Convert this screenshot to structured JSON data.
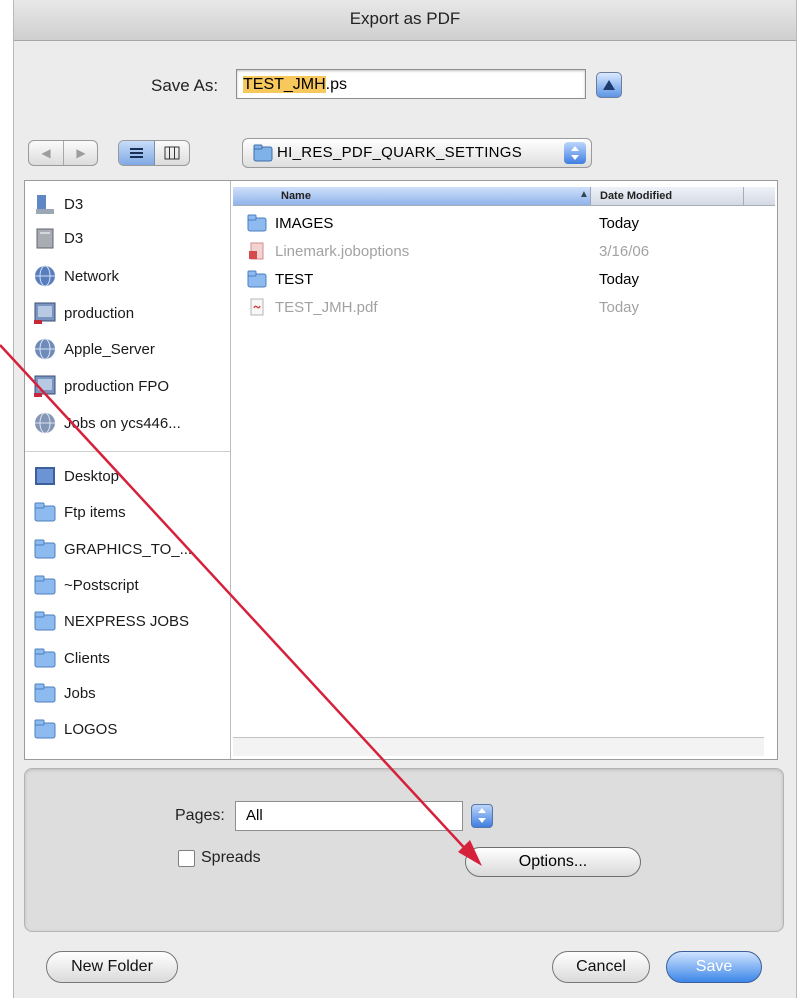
{
  "window": {
    "title": "Export as PDF"
  },
  "save_as": {
    "label": "Save As:",
    "value_selected": "TEST_JMH",
    "value_ext": ".ps"
  },
  "nav": {
    "back": "◀",
    "forward": "▶"
  },
  "path_popup": {
    "label": "HI_RES_PDF_QUARK_SETTINGS"
  },
  "sidebar": {
    "devices": [
      {
        "label": "D3",
        "icon": "disk-icon"
      },
      {
        "label": "D3",
        "icon": "hard-drive-icon"
      },
      {
        "label": "Network",
        "icon": "network-globe-icon"
      },
      {
        "label": "production",
        "icon": "server-volume-icon"
      },
      {
        "label": "Apple_Server",
        "icon": "network-globe-icon"
      },
      {
        "label": "production FPO",
        "icon": "server-volume-icon"
      },
      {
        "label": "Jobs on ycs446...",
        "icon": "network-globe-icon"
      }
    ],
    "places": [
      {
        "label": "Desktop",
        "icon": "desktop-icon"
      },
      {
        "label": "Ftp items",
        "icon": "folder-icon"
      },
      {
        "label": "GRAPHICS_TO_...",
        "icon": "folder-icon"
      },
      {
        "label": "~Postscript",
        "icon": "folder-icon"
      },
      {
        "label": "NEXPRESS JOBS",
        "icon": "folder-icon"
      },
      {
        "label": "Clients",
        "icon": "folder-icon"
      },
      {
        "label": "Jobs",
        "icon": "folder-icon"
      },
      {
        "label": "LOGOS",
        "icon": "folder-icon"
      }
    ]
  },
  "file_list": {
    "col_name": "Name",
    "col_date": "Date Modified",
    "rows": [
      {
        "name": "IMAGES",
        "date": "Today",
        "icon": "folder-icon",
        "enabled": true
      },
      {
        "name": "Linemark.joboptions",
        "date": "3/16/06",
        "icon": "joboptions-file-icon",
        "enabled": false
      },
      {
        "name": "TEST",
        "date": "Today",
        "icon": "folder-icon",
        "enabled": true
      },
      {
        "name": "TEST_JMH.pdf",
        "date": "Today",
        "icon": "pdf-file-icon",
        "enabled": false
      }
    ]
  },
  "options": {
    "pages_label": "Pages:",
    "pages_value": "All",
    "spreads_label": "Spreads",
    "options_button": "Options..."
  },
  "buttons": {
    "new_folder": "New Folder",
    "cancel": "Cancel",
    "save": "Save"
  },
  "colors": {
    "selection": "#f7c85c",
    "accent": "#3d86e8",
    "annotation_arrow": "#d6213a"
  }
}
